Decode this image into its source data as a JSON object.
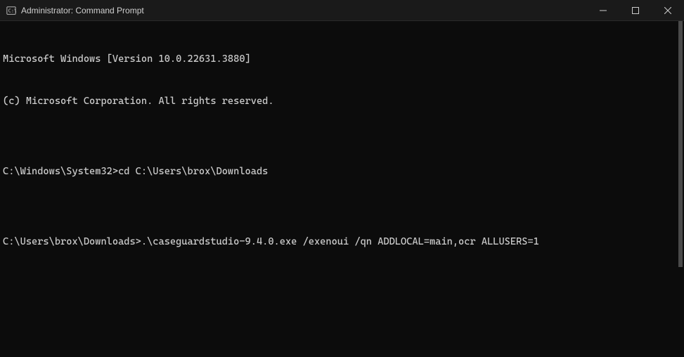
{
  "window": {
    "title": "Administrator: Command Prompt"
  },
  "terminal": {
    "lines": [
      {
        "text": "Microsoft Windows [Version 10.0.22631.3880]"
      },
      {
        "text": "(c) Microsoft Corporation. All rights reserved."
      },
      {
        "text": ""
      },
      {
        "prompt": "C:\\Windows\\System32>",
        "command": "cd C:\\Users\\brox\\Downloads"
      },
      {
        "text": ""
      },
      {
        "prompt": "C:\\Users\\brox\\Downloads>",
        "command": ".\\caseguardstudio-9.4.0.exe /exenoui /qn ADDLOCAL=main,ocr ALLUSERS=1"
      }
    ]
  }
}
